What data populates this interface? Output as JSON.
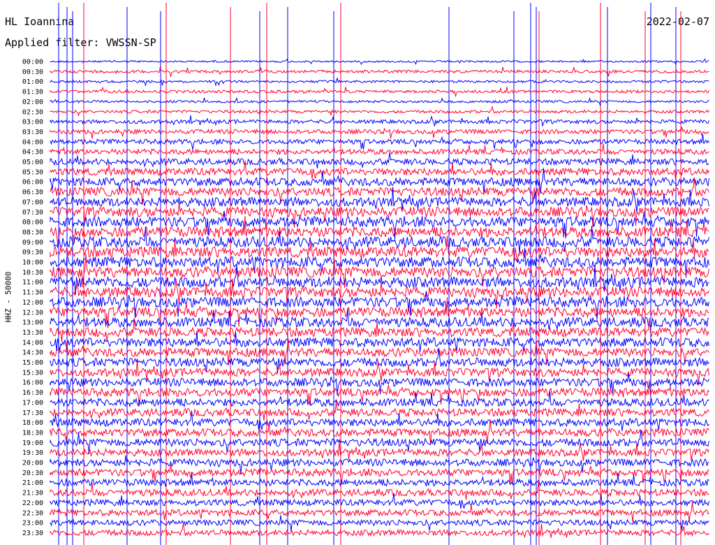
{
  "header": {
    "station": "HL Ioannina",
    "filter": "Applied filter: VWSSN-SP",
    "date": "2022-02-07"
  },
  "chart_data": {
    "type": "line",
    "title": "HL Ioannina",
    "subtitle": "Applied filter: VWSSN-SP",
    "date": "2022-02-07",
    "ylabel": "HHZ - 50000",
    "xlabel": "",
    "colors": {
      "blue": "#0000ff",
      "red": "#ff0033"
    },
    "rows": [
      "00:00",
      "00:30",
      "01:00",
      "01:30",
      "02:00",
      "02:30",
      "03:00",
      "03:30",
      "04:00",
      "04:30",
      "05:00",
      "05:30",
      "06:00",
      "06:30",
      "07:00",
      "07:30",
      "08:00",
      "08:30",
      "09:00",
      "09:30",
      "10:00",
      "10:30",
      "11:00",
      "11:30",
      "12:00",
      "12:30",
      "13:00",
      "13:30",
      "14:00",
      "14:30",
      "15:00",
      "15:30",
      "16:00",
      "16:30",
      "17:00",
      "17:30",
      "18:00",
      "18:30",
      "19:00",
      "19:30",
      "20:00",
      "20:30",
      "21:00",
      "21:30",
      "22:00",
      "22:30",
      "23:00",
      "23:30"
    ],
    "row_colors": "alternating blue/red starting with blue",
    "noise_level_relative": [
      0.4,
      0.6,
      0.5,
      0.6,
      0.5,
      0.6,
      0.8,
      0.9,
      1.0,
      1.1,
      1.3,
      1.5,
      1.7,
      1.8,
      1.9,
      2.0,
      2.1,
      2.1,
      2.2,
      2.2,
      2.2,
      2.2,
      2.2,
      2.1,
      2.1,
      2.0,
      2.0,
      1.9,
      1.9,
      1.8,
      1.8,
      1.7,
      1.7,
      1.7,
      1.6,
      1.6,
      1.6,
      1.6,
      1.6,
      1.5,
      1.5,
      1.5,
      1.4,
      1.4,
      1.3,
      1.3,
      1.2,
      1.2
    ],
    "grid": false,
    "legend": "none"
  }
}
